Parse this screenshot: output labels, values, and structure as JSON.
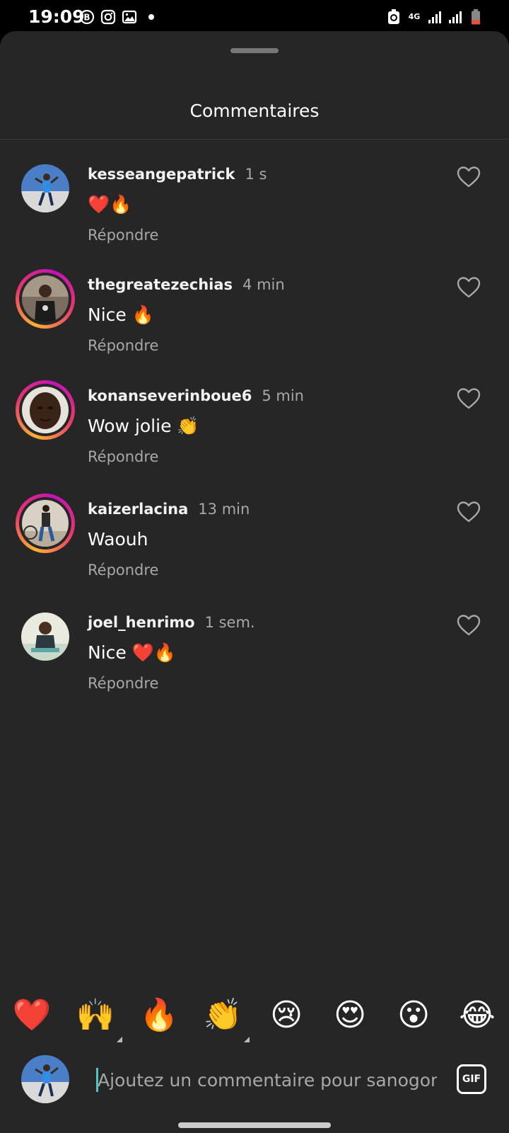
{
  "status_bar": {
    "time": "19:09",
    "network": "4G",
    "left_icons": [
      "b-circle-icon",
      "instagram-icon",
      "gallery-icon",
      "notification-dot-icon"
    ],
    "right_icons": [
      "recycle-icon",
      "network-4g-icon",
      "signal-icon",
      "signal-icon",
      "battery-low-icon"
    ],
    "battery_color": "#e5533c"
  },
  "sheet": {
    "title": "Commentaires"
  },
  "colors": {
    "background": "#262626",
    "muted_text": "#a8a8a8",
    "story_ring": [
      "#f9b233",
      "#e8356d",
      "#c511b8"
    ],
    "caret": "#4fc3c8"
  },
  "comments": [
    {
      "username": "kesseangepatrick",
      "time": "1 s",
      "text": "❤️🔥",
      "reply": "Répondre",
      "story_ring": false
    },
    {
      "username": "thegreatezechias",
      "time": "4 min",
      "text": "Nice 🔥",
      "reply": "Répondre",
      "story_ring": true
    },
    {
      "username": "konanseverinboue6",
      "time": "5 min",
      "text": "Wow jolie 👏",
      "reply": "Répondre",
      "story_ring": true
    },
    {
      "username": "kaizerlacina",
      "time": "13 min",
      "text": "Waouh",
      "reply": "Répondre",
      "story_ring": true
    },
    {
      "username": "joel_henrimo",
      "time": "1 sem.",
      "text": "Nice ❤️🔥",
      "reply": "Répondre",
      "story_ring": false
    }
  ],
  "emoji_bar": [
    "❤️",
    "🙌",
    "🔥",
    "👏",
    "😢",
    "😍",
    "😮",
    "😂"
  ],
  "input": {
    "placeholder": "Ajoutez un commentaire pour sanogomou",
    "gif_label": "GIF"
  }
}
